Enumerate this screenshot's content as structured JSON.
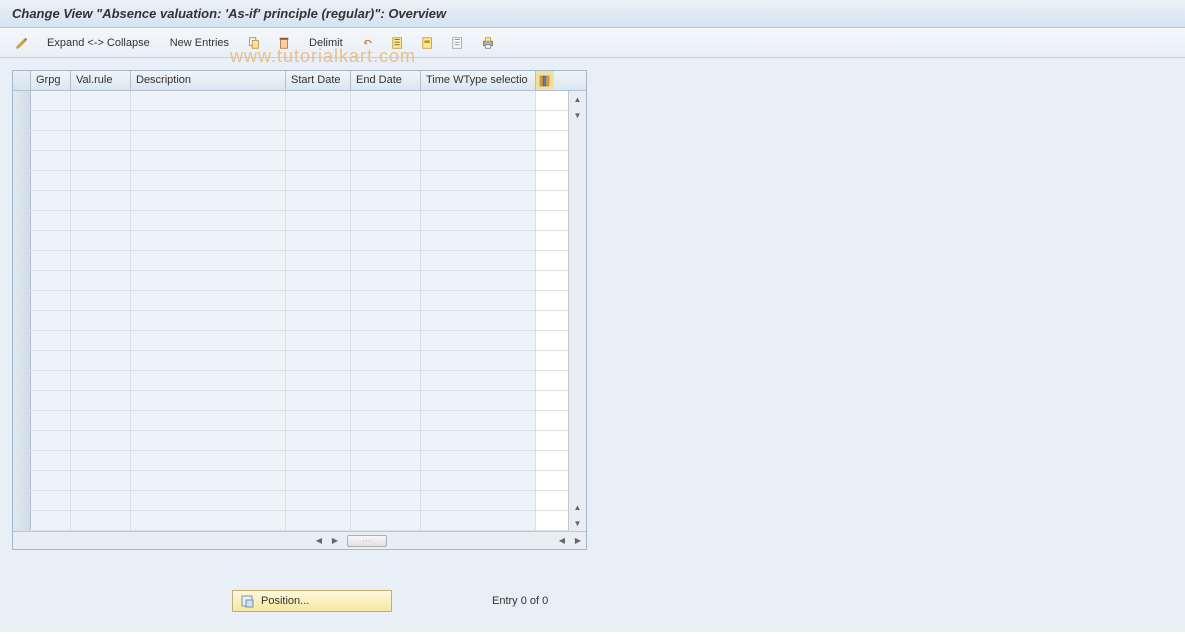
{
  "title": "Change View \"Absence valuation: 'As-if' principle (regular)\": Overview",
  "toolbar": {
    "expand_collapse": "Expand <-> Collapse",
    "new_entries": "New Entries",
    "delimit": "Delimit"
  },
  "columns": {
    "grpg": "Grpg",
    "valrule": "Val.rule",
    "description": "Description",
    "start_date": "Start Date",
    "end_date": "End Date",
    "time_wtype": "Time WType selectio"
  },
  "rows": [
    {},
    {},
    {},
    {},
    {},
    {},
    {},
    {},
    {},
    {},
    {},
    {},
    {},
    {},
    {},
    {},
    {},
    {},
    {},
    {},
    {},
    {}
  ],
  "footer": {
    "position_label": "Position...",
    "entry_text": "Entry 0 of 0"
  },
  "watermark": "www.tutorialkart.com"
}
